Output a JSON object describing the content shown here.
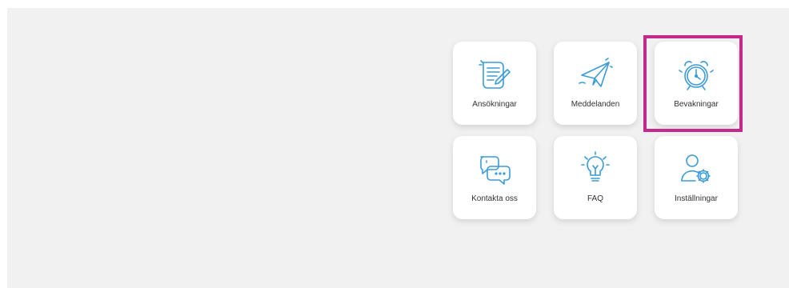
{
  "colors": {
    "accent": "#3a9bd8",
    "highlight": "#c42a8a",
    "panel": "#f1f1f2"
  },
  "tiles": [
    {
      "label": "Ansökningar",
      "icon": "document-edit-icon"
    },
    {
      "label": "Meddelanden",
      "icon": "paper-plane-icon"
    },
    {
      "label": "Bevakningar",
      "icon": "alarm-clock-icon"
    },
    {
      "label": "Kontakta oss",
      "icon": "chat-bubbles-icon"
    },
    {
      "label": "FAQ",
      "icon": "lightbulb-icon"
    },
    {
      "label": "Inställningar",
      "icon": "user-settings-icon"
    }
  ]
}
